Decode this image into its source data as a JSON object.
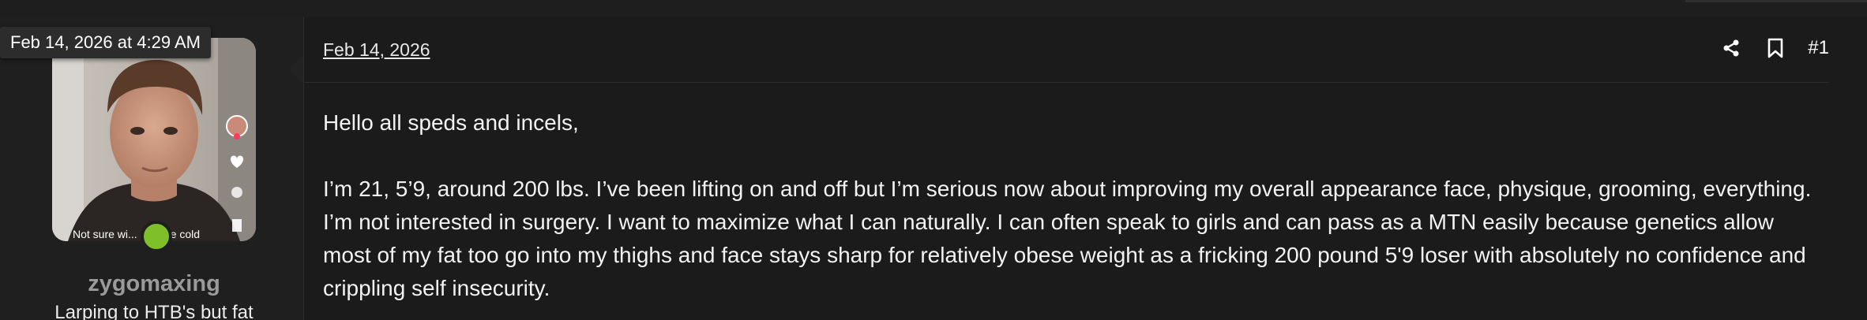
{
  "tooltip": {
    "text": "Feb 14, 2026 at 4:29 AM"
  },
  "user": {
    "username": "zygomaxing",
    "title": "Larping to HTB's but fat",
    "avatar_caption": "Not sure wi... a stone cold",
    "online_color": "#7fbf2a"
  },
  "post": {
    "date": "Feb 14, 2026",
    "number": "#1",
    "share_icon": "share-icon",
    "bookmark_icon": "bookmark-icon",
    "greeting": "Hello all speds and incels,",
    "body": "I’m 21, 5’9, around 200 lbs. I’ve been lifting on and off but I’m serious now about improving my overall appearance face, physique, grooming, everything. I’m not interested in surgery. I want to maximize what I can naturally. I can often speak to girls and can pass as a MTN easily because genetics allow most of my fat too go into my thighs and face stays sharp for relatively obese weight as a fricking 200 pound 5'9 loser with absolutely no confidence and crippling self insecurity."
  },
  "colors": {
    "background": "#1b1b1b",
    "panel": "#1f1f1f",
    "username": "#9a9a9a",
    "text": "#f2f2f2"
  }
}
